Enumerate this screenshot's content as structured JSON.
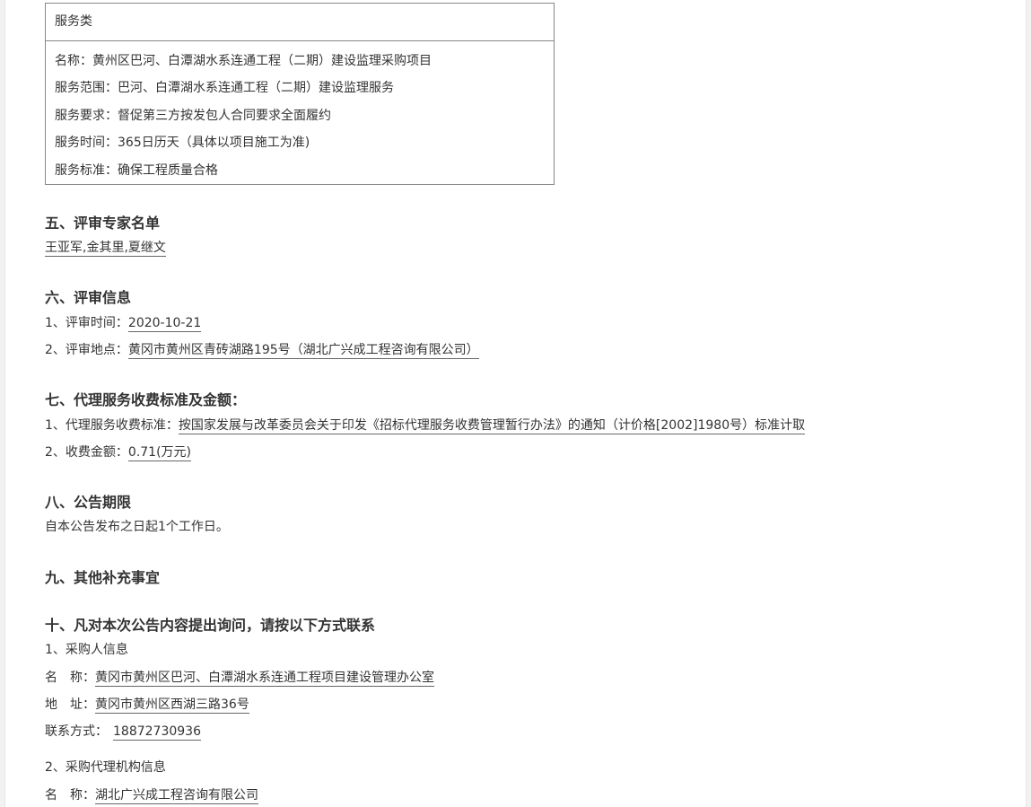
{
  "service_box": {
    "header": "服务类",
    "rows": [
      "名称：黄州区巴河、白潭湖水系连通工程（二期）建设监理采购项目",
      "服务范围：巴河、白潭湖水系连通工程（二期）建设监理服务",
      "服务要求：督促第三方按发包人合同要求全面履约",
      "服务时间：365日历天（具体以项目施工为准)",
      "服务标准：确保工程质量合格"
    ]
  },
  "section5": {
    "title": "五、评审专家名单",
    "experts": "王亚军,金其里,夏继文"
  },
  "section6": {
    "title": "六、评审信息",
    "time_label": "1、评审时间：",
    "time_value": "2020-10-21",
    "place_label": "2、评审地点：",
    "place_value": "黄冈市黄州区青砖湖路195号（湖北广兴成工程咨询有限公司）"
  },
  "section7": {
    "title": "七、代理服务收费标准及金额：",
    "standard_label": "1、代理服务收费标准：",
    "standard_value": "按国家发展与改革委员会关于印发《招标代理服务收费管理暂行办法》的通知（计价格[2002]1980号）标准计取",
    "amount_label": "2、收费金额：",
    "amount_value": "0.71(万元)"
  },
  "section8": {
    "title": "八、公告期限",
    "text": "自本公告发布之日起1个工作日。"
  },
  "section9": {
    "title": "九、其他补充事宜"
  },
  "section10": {
    "title": "十、凡对本次公告内容提出询问，请按以下方式联系",
    "purchaser_heading": "1、采购人信息",
    "purchaser_name_label": "名　称：",
    "purchaser_name_value": "黄冈市黄州区巴河、白潭湖水系连通工程项目建设管理办公室",
    "purchaser_addr_label": "地　址：",
    "purchaser_addr_value": "黄冈市黄州区西湖三路36号",
    "purchaser_contact_label": "联系方式：",
    "purchaser_contact_value": "18872730936",
    "agency_heading": "2、采购代理机构信息",
    "agency_name_label": "名　称：",
    "agency_name_value": "湖北广兴成工程咨询有限公司"
  }
}
